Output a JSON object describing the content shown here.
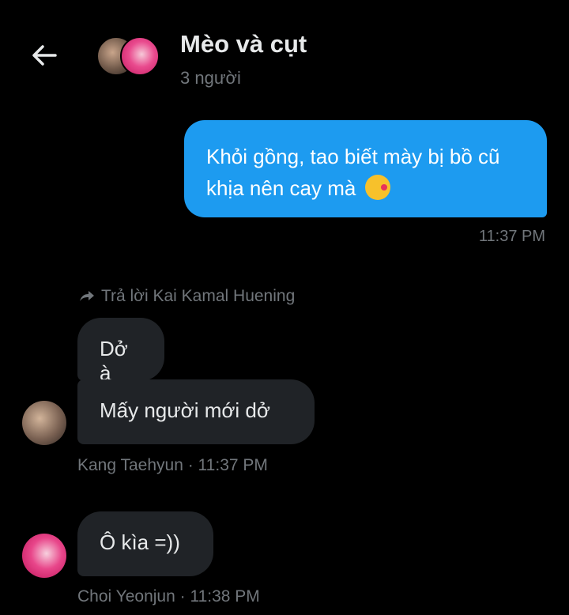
{
  "header": {
    "back_icon": "arrow-left-icon",
    "title": "Mèo và cụt",
    "subtitle": "3 người"
  },
  "messages": {
    "outgoing": {
      "text": "Khỏi gồng, tao biết mày bị bồ cũ khịa nên cay mà",
      "emoji": "kissing-face-emoji",
      "time": "11:37 PM",
      "color": "#1d9bf0"
    },
    "reply_context": {
      "icon": "reply-arrow-icon",
      "text": "Trả lời Kai Kamal Huening"
    },
    "group1": {
      "bubble1": "Dở à",
      "bubble2": "Mấy người mới dở",
      "meta": "Kang Taehyun · 11:37 PM"
    },
    "group2": {
      "bubble1": "Ô kìa =))",
      "meta": "Choi Yeonjun · 11:38 PM"
    }
  }
}
